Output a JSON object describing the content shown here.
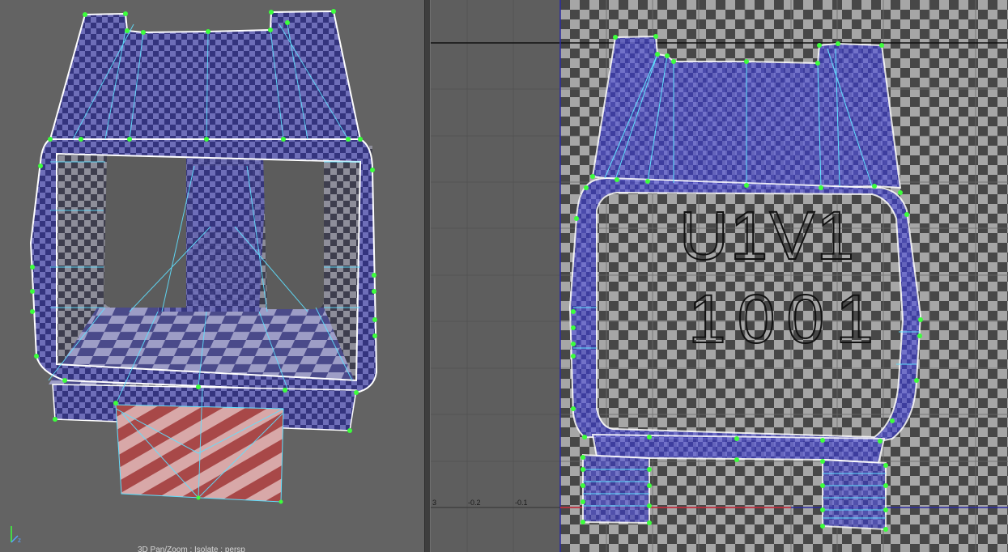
{
  "viewport3d": {
    "camera_label": "3D Pan/Zoom : Isolate : persp",
    "axis_label": "z"
  },
  "uv_editor": {
    "tile_label_line1": "U1V1",
    "tile_label_line2": "1001",
    "ruler_labels": [
      "3",
      "-0.2",
      "-0.1"
    ]
  },
  "colors": {
    "uv_shell_fill": "#4a4ab8",
    "checker_dark": "#3a3a3a",
    "checker_light": "#8a8a8a",
    "vertex": "#3cff3c",
    "edge": "#5fe0ff",
    "border": "#ffffff",
    "flipped_face": "#b04848"
  }
}
